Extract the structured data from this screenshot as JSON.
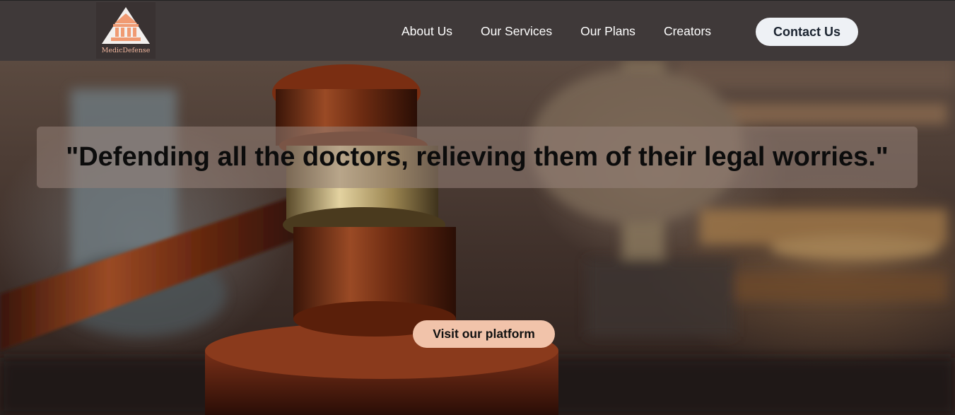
{
  "brand": {
    "logo_text": "MedicDefense",
    "logo_icon": "courthouse-icon"
  },
  "nav": {
    "items": [
      {
        "label": "About Us"
      },
      {
        "label": "Our Services"
      },
      {
        "label": "Our Plans"
      },
      {
        "label": "Creators"
      }
    ],
    "contact_label": "Contact Us"
  },
  "hero": {
    "background_image": "gavel-and-scales-photo",
    "quote": "\"Defending all the doctors, relieving them of their legal worries.\"",
    "cta_label": "Visit our platform"
  },
  "colors": {
    "navbar": "#3f3939",
    "accent": "#f1c3aa",
    "contact_button": "#eef1f5"
  }
}
